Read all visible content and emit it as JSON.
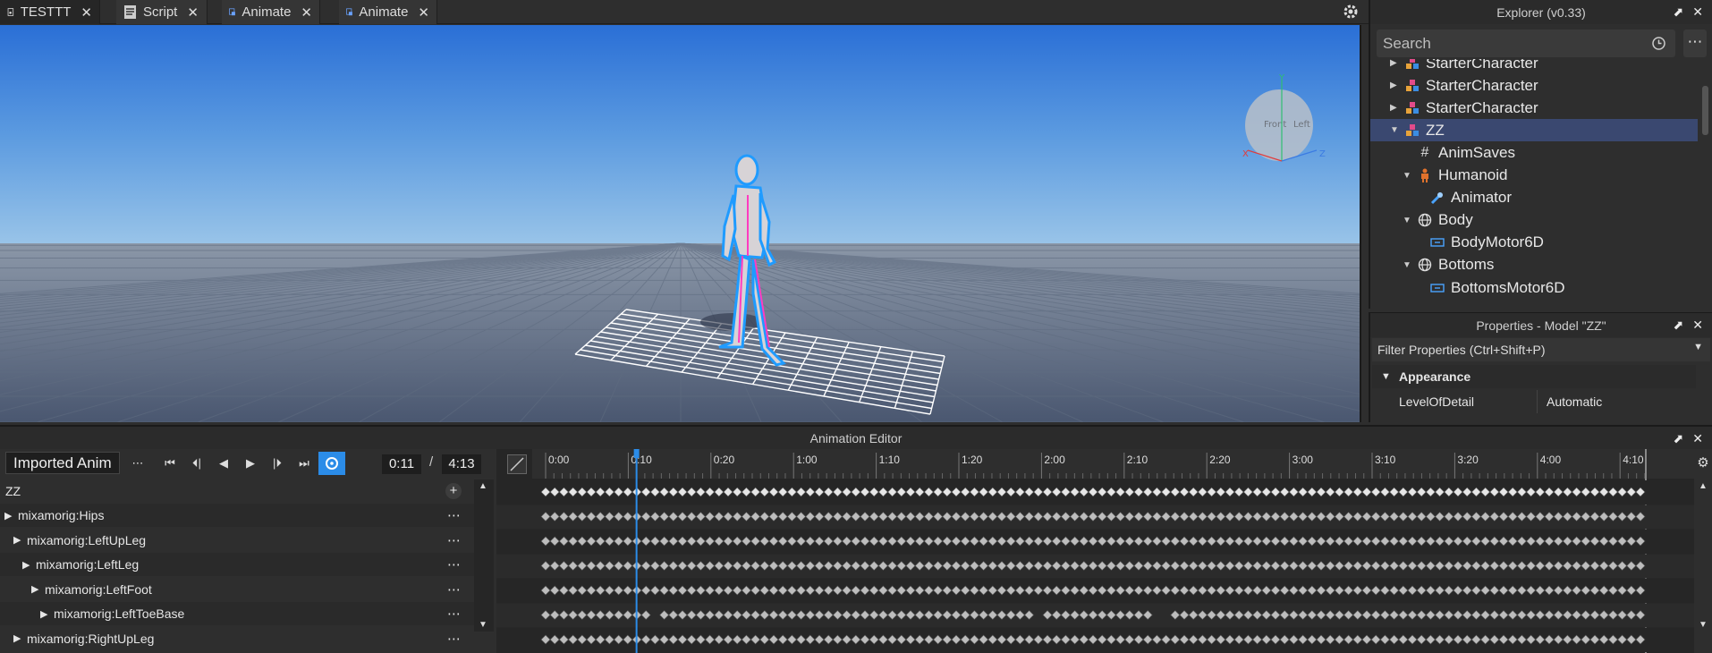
{
  "tabs": [
    {
      "label": "TESTTT",
      "icon": "place-icon"
    },
    {
      "label": "Script",
      "icon": "script-icon"
    },
    {
      "label": "Animate",
      "icon": "animate-script-icon"
    },
    {
      "label": "Animate",
      "icon": "animate-script-icon"
    }
  ],
  "viewport": {
    "view_cube_labels": {
      "front": "Front",
      "left": "Left"
    },
    "axis_labels": {
      "x": "X",
      "y": "Y",
      "z": "Z"
    }
  },
  "explorer": {
    "title": "Explorer (v0.33)",
    "search_placeholder": "Search",
    "items": [
      {
        "label": "StarterCharacter",
        "icon": "model-icon",
        "expanded": false
      },
      {
        "label": "StarterCharacter",
        "icon": "model-icon",
        "expanded": false
      },
      {
        "label": "StarterCharacter",
        "icon": "model-icon",
        "expanded": false
      },
      {
        "label": "ZZ",
        "icon": "model-icon",
        "expanded": true,
        "selected": true
      },
      {
        "label": "AnimSaves",
        "icon": "hash-icon"
      },
      {
        "label": "Humanoid",
        "icon": "humanoid-icon",
        "expanded": true
      },
      {
        "label": "Animator",
        "icon": "animator-icon"
      },
      {
        "label": "Body",
        "icon": "meshpart-icon",
        "expanded": true
      },
      {
        "label": "BodyMotor6D",
        "icon": "motor6d-icon"
      },
      {
        "label": "Bottoms",
        "icon": "meshpart-icon",
        "expanded": true
      },
      {
        "label": "BottomsMotor6D",
        "icon": "motor6d-icon"
      }
    ]
  },
  "properties": {
    "title": "Properties - Model \"ZZ\"",
    "filter_placeholder": "Filter Properties (Ctrl+Shift+P)",
    "category": "Appearance",
    "rows": [
      {
        "name": "LevelOfDetail",
        "value": "Automatic"
      }
    ]
  },
  "animation_editor": {
    "title": "Animation Editor",
    "animation_name": "Imported Anim",
    "current_time": "0:11",
    "separator": "/",
    "end_time": "4:13",
    "root": "ZZ",
    "tracks": [
      {
        "label": "mixamorig:Hips",
        "depth": 0
      },
      {
        "label": "mixamorig:LeftUpLeg",
        "depth": 1
      },
      {
        "label": "mixamorig:LeftLeg",
        "depth": 2
      },
      {
        "label": "mixamorig:LeftFoot",
        "depth": 3
      },
      {
        "label": "mixamorig:LeftToeBase",
        "depth": 4
      },
      {
        "label": "mixamorig:RightUpLeg",
        "depth": 1
      }
    ],
    "ruler_ticks": [
      "0:00",
      "0:10",
      "0:20",
      "1:00",
      "1:10",
      "1:20",
      "2:00",
      "2:10",
      "2:20",
      "3:00",
      "3:10",
      "3:20",
      "4:00",
      "4:10"
    ],
    "scrubber_time": "0:11",
    "accent_color": "#2b8ce8"
  }
}
